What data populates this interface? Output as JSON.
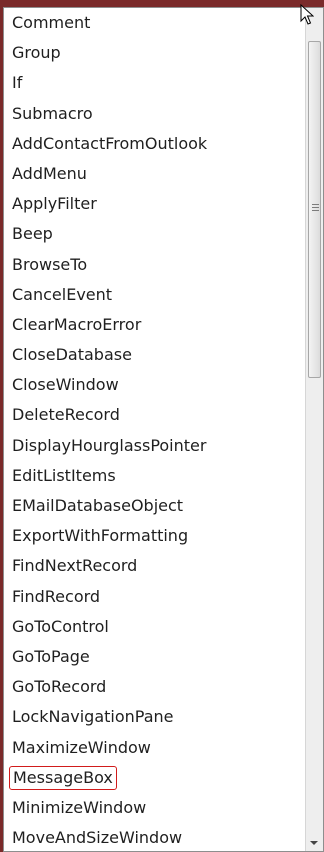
{
  "list": {
    "items": [
      {
        "label": "Comment"
      },
      {
        "label": "Group"
      },
      {
        "label": "If"
      },
      {
        "label": "Submacro"
      },
      {
        "label": "AddContactFromOutlook"
      },
      {
        "label": "AddMenu"
      },
      {
        "label": "ApplyFilter"
      },
      {
        "label": "Beep"
      },
      {
        "label": "BrowseTo"
      },
      {
        "label": "CancelEvent"
      },
      {
        "label": "ClearMacroError"
      },
      {
        "label": "CloseDatabase"
      },
      {
        "label": "CloseWindow"
      },
      {
        "label": "DeleteRecord"
      },
      {
        "label": "DisplayHourglassPointer"
      },
      {
        "label": "EditListItems"
      },
      {
        "label": "EMailDatabaseObject"
      },
      {
        "label": "ExportWithFormatting"
      },
      {
        "label": "FindNextRecord"
      },
      {
        "label": "FindRecord"
      },
      {
        "label": "GoToControl"
      },
      {
        "label": "GoToPage"
      },
      {
        "label": "GoToRecord"
      },
      {
        "label": "LockNavigationPane"
      },
      {
        "label": "MaximizeWindow"
      },
      {
        "label": "MessageBox"
      },
      {
        "label": "MinimizeWindow"
      },
      {
        "label": "MoveAndSizeWindow"
      }
    ],
    "highlighted_item": "MessageBox"
  },
  "colors": {
    "highlight_border": "#d11b1b",
    "background": "#7a2a2a"
  },
  "icons": {
    "cursor": "mouse-pointer-icon",
    "scroll_down": "chevron-down-icon"
  }
}
